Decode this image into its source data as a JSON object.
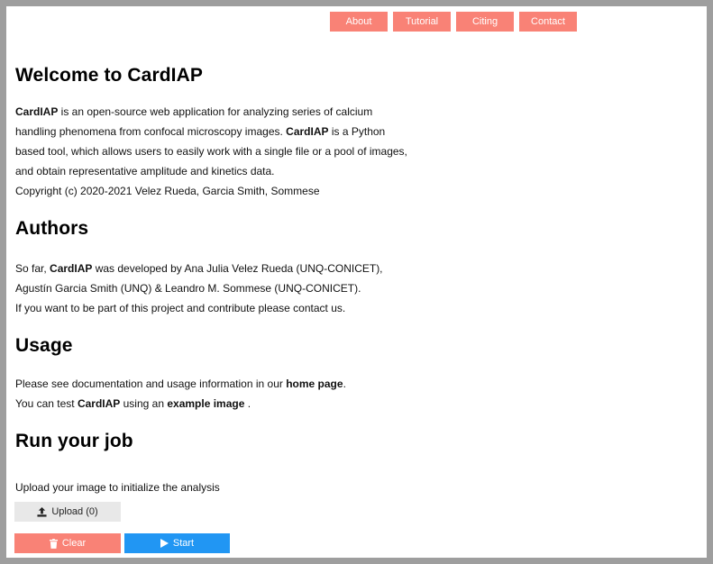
{
  "nav": {
    "about": "About",
    "tutorial": "Tutorial",
    "citing": "Citing",
    "contact": "Contact"
  },
  "welcome": {
    "title": "Welcome to CardIAP",
    "app_name": "CardIAP",
    "text1": " is an open-source web application for analyzing series of calcium",
    "text2": "handling phenomena from confocal microscopy images. ",
    "text3": " is a Python",
    "text4": "based tool, which allows users to easily work with a single file or a pool of images,",
    "text5": "and obtain representative amplitude and kinetics data.",
    "copyright": "Copyright (c) 2020-2021 Velez Rueda, Garcia Smith, Sommese"
  },
  "authors": {
    "title": "Authors",
    "text1a": "So far, ",
    "text1b": " was developed by Ana Julia Velez Rueda (UNQ-CONICET),",
    "text2": "Agustín Garcia Smith (UNQ) & Leandro M. Sommese (UNQ-CONICET).",
    "text3": "If you want to be part of this project and contribute please contact us."
  },
  "usage": {
    "title": "Usage",
    "text1a": "Please see documentation and usage information in our ",
    "home_link": "home page",
    "text1b": ".",
    "text2a": "You can test ",
    "text2b": " using an ",
    "example_link": "example image",
    "text2c": " ."
  },
  "job": {
    "title": "Run your job",
    "instruction": "Upload your image to initialize the analysis",
    "upload_label": "Upload (0)",
    "clear_label": "Clear",
    "start_label": "Start"
  },
  "colors": {
    "accent": "#f98276",
    "primary": "#2196f3",
    "upload_bg": "#e8e8e8"
  },
  "icons": {
    "upload": "upload-icon",
    "clear": "trash-icon",
    "start": "play-icon"
  }
}
